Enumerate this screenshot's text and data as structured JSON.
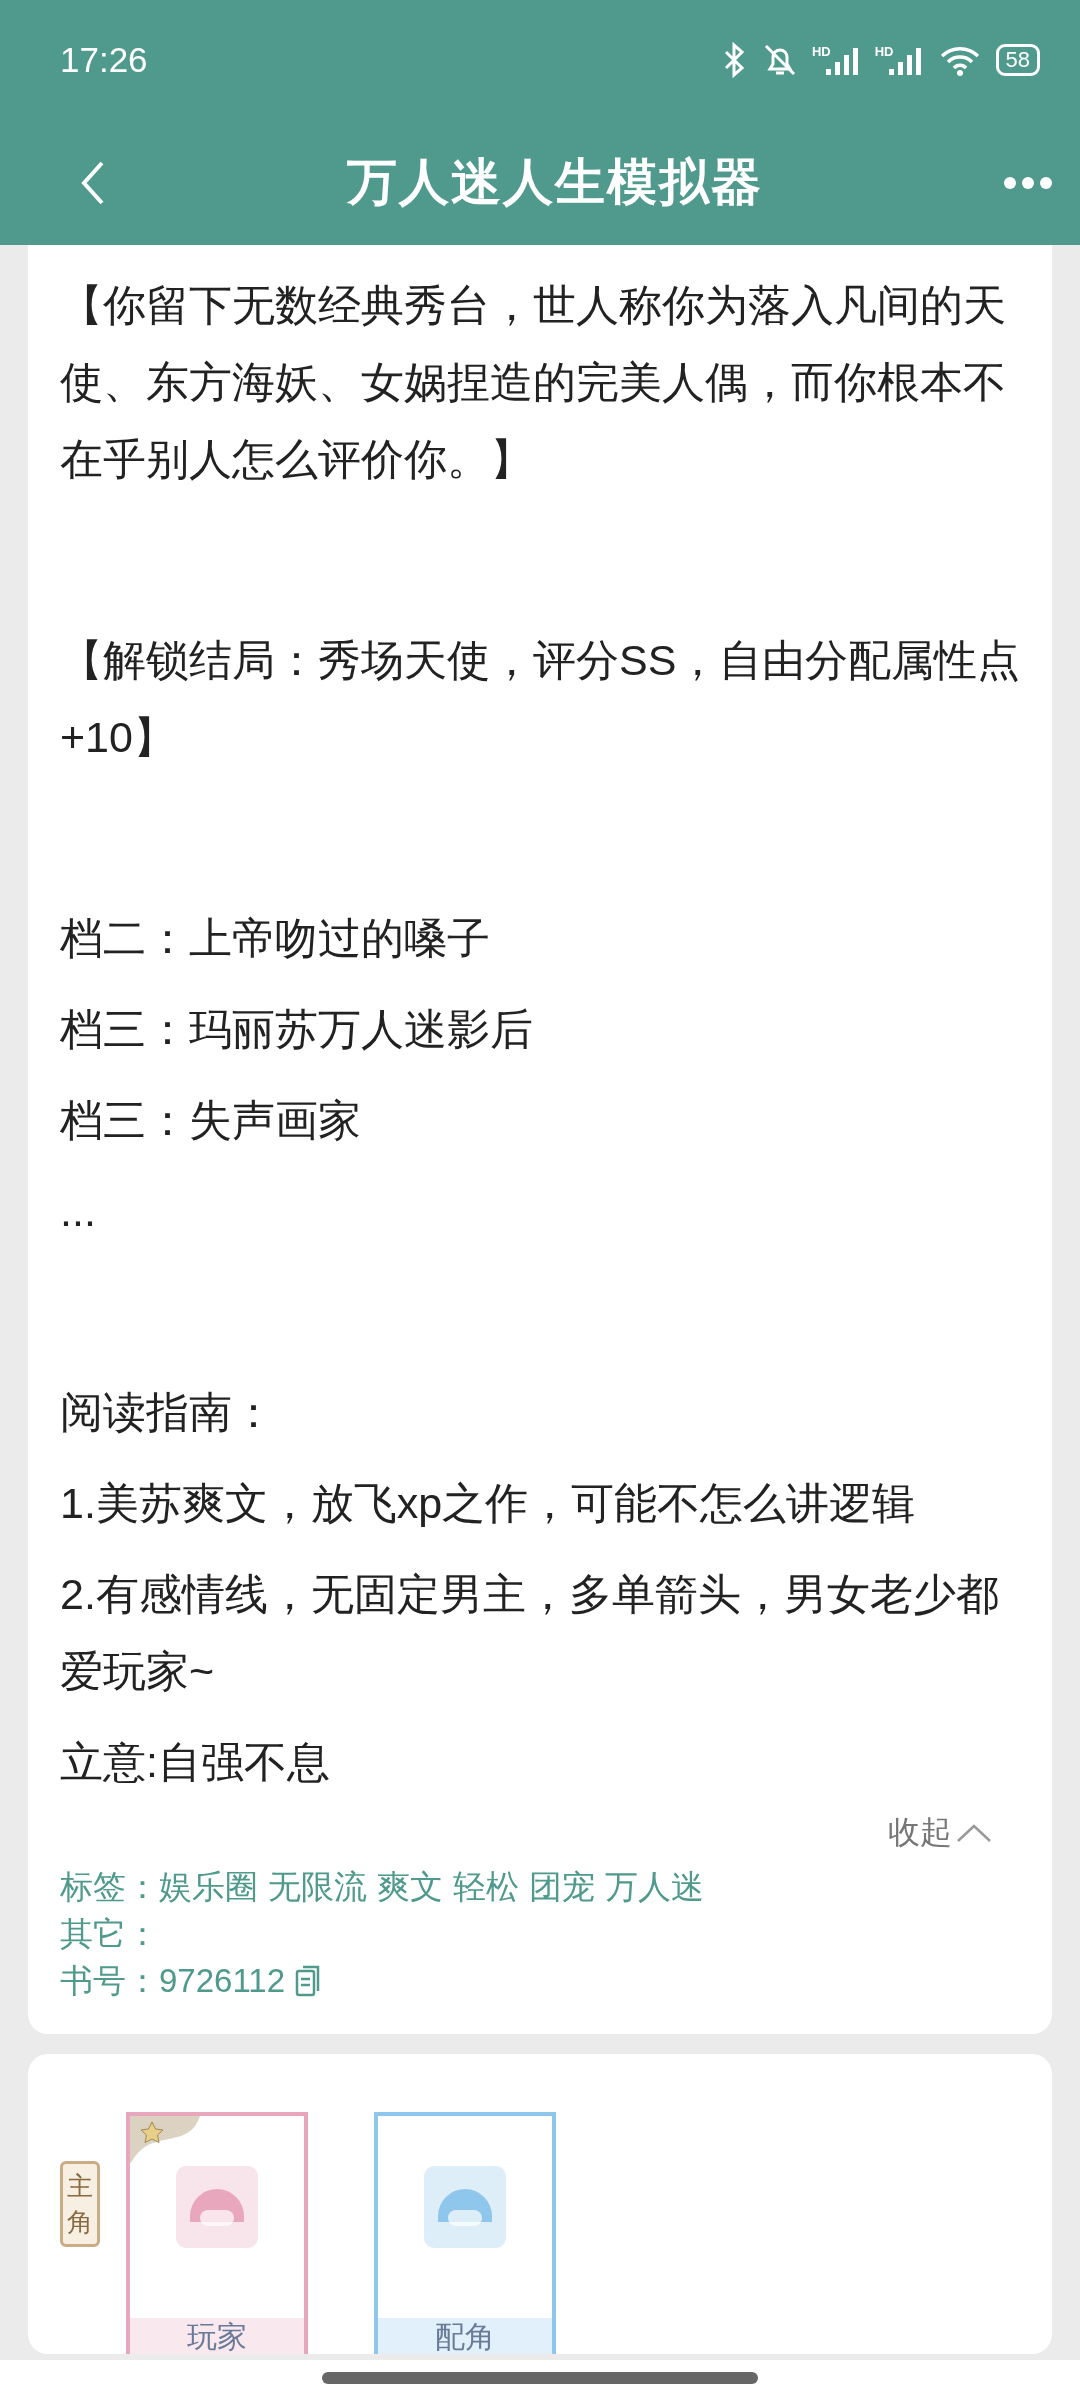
{
  "status_bar": {
    "time": "17:26",
    "battery": "58",
    "network_labels": [
      "HD",
      "HD"
    ]
  },
  "header": {
    "title": "万人迷人生模拟器"
  },
  "intro": [
    {
      "kind": "text",
      "text": "【你留下无数经典秀台，世人称你为落入凡间的天使、东方海妖、女娲捏造的完美人偶，而你根本不在乎别人怎么评价你。】"
    },
    {
      "kind": "blank"
    },
    {
      "kind": "text",
      "text": "【解锁结局：秀场天使，评分SS，自由分配属性点+10】"
    },
    {
      "kind": "blank"
    },
    {
      "kind": "text",
      "text": "档二：上帝吻过的嗓子"
    },
    {
      "kind": "text",
      "text": "档三：玛丽苏万人迷影后"
    },
    {
      "kind": "text",
      "text": "档三：失声画家"
    },
    {
      "kind": "text",
      "text": "..."
    },
    {
      "kind": "blank"
    },
    {
      "kind": "text",
      "text": "阅读指南："
    },
    {
      "kind": "text",
      "text": "1.美苏爽文，放飞xp之作，可能不怎么讲逻辑"
    },
    {
      "kind": "text",
      "text": "2.有感情线，无固定男主，多单箭头，男女老少都爱玩家~"
    },
    {
      "kind": "text",
      "text": "立意:自强不息"
    }
  ],
  "collapse_link": "收起",
  "meta": {
    "tags_label": "标签：",
    "tags": [
      "娱乐圈",
      "无限流",
      "爽文",
      "轻松",
      "团宠",
      "万人迷"
    ],
    "other_label": "其它：",
    "book_no_label": "书号：",
    "book_no": "9726112"
  },
  "roles": {
    "badge": "主角",
    "characters": [
      {
        "name": "玩家",
        "color": "#e9a7bd",
        "starred": true
      },
      {
        "name": "配角",
        "color": "#8fc6ec",
        "starred": false
      }
    ]
  }
}
